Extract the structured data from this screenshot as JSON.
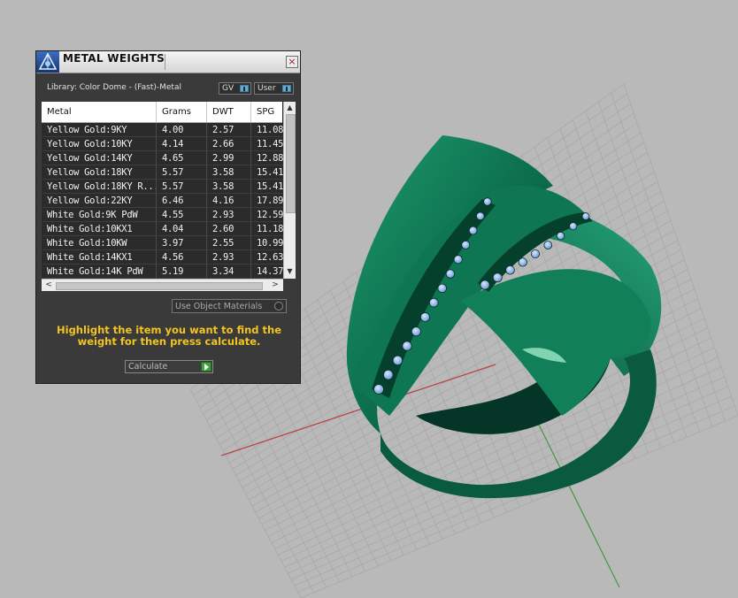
{
  "panel": {
    "title": "METAL WEIGHTS",
    "close_glyph": "×",
    "library_label": "Library: Color Dome - (Fast)-Metal",
    "gv_label": "GV",
    "user_label": "User",
    "icons": [
      "app-icon",
      "close-icon"
    ]
  },
  "table": {
    "columns": [
      "Metal",
      "Grams",
      "DWT",
      "SPG"
    ],
    "rows": [
      [
        "Yellow Gold:9KY",
        "4.00",
        "2.57",
        "11.08"
      ],
      [
        "Yellow Gold:10KY",
        "4.14",
        "2.66",
        "11.45"
      ],
      [
        "Yellow Gold:14KY",
        "4.65",
        "2.99",
        "12.88"
      ],
      [
        "Yellow Gold:18KY",
        "5.57",
        "3.58",
        "15.41"
      ],
      [
        "Yellow Gold:18KY R...",
        "5.57",
        "3.58",
        "15.41"
      ],
      [
        "Yellow Gold:22KY",
        "6.46",
        "4.16",
        "17.89"
      ],
      [
        "White Gold:9K PdW",
        "4.55",
        "2.93",
        "12.59"
      ],
      [
        "White Gold:10KX1",
        "4.04",
        "2.60",
        "11.18"
      ],
      [
        "White Gold:10KW",
        "3.97",
        "2.55",
        "10.99"
      ],
      [
        "White Gold:14KX1",
        "4.56",
        "2.93",
        "12.63"
      ],
      [
        "White Gold:14K PdW",
        "5.19",
        "3.34",
        "14.37"
      ]
    ],
    "scroll_up": "▲",
    "scroll_down": "▼",
    "scroll_left": "<",
    "scroll_right": ">"
  },
  "options": {
    "use_object_materials": "Use Object Materials"
  },
  "instruction": "Highlight the item you want to find the weight for then press calculate.",
  "calculate": {
    "label": "Calculate"
  },
  "viewport": {
    "background": "#b9b9b9",
    "grid_color": "#a4a4a4",
    "ring_color": "#0b6a4c",
    "gem_color": "#8fb7f0",
    "x_axis_color": "#b84545",
    "y_axis_color": "#4a9a4a"
  }
}
